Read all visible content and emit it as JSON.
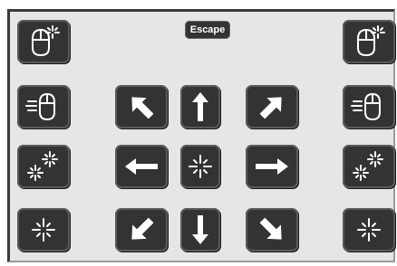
{
  "toolbar": {
    "escape_label": "Escape"
  },
  "left_column": [
    {
      "icon": "mouse-click-icon"
    },
    {
      "icon": "mouse-move-icon"
    },
    {
      "icon": "double-click-icon"
    },
    {
      "icon": "single-click-icon"
    }
  ],
  "right_column": [
    {
      "icon": "mouse-click-icon"
    },
    {
      "icon": "mouse-move-icon"
    },
    {
      "icon": "double-click-icon"
    },
    {
      "icon": "single-click-icon"
    }
  ],
  "dpad": [
    {
      "icon": "arrow-up-left-icon"
    },
    {
      "icon": "arrow-up-icon"
    },
    {
      "icon": "arrow-up-right-icon"
    },
    {
      "icon": "arrow-left-icon"
    },
    {
      "icon": "center-click-icon"
    },
    {
      "icon": "arrow-right-icon"
    },
    {
      "icon": "arrow-down-left-icon"
    },
    {
      "icon": "arrow-down-icon"
    },
    {
      "icon": "arrow-down-right-icon"
    }
  ],
  "colors": {
    "panel_background": "#e6e6e6",
    "button_background": "#333333",
    "icon_color": "#ffffff"
  }
}
